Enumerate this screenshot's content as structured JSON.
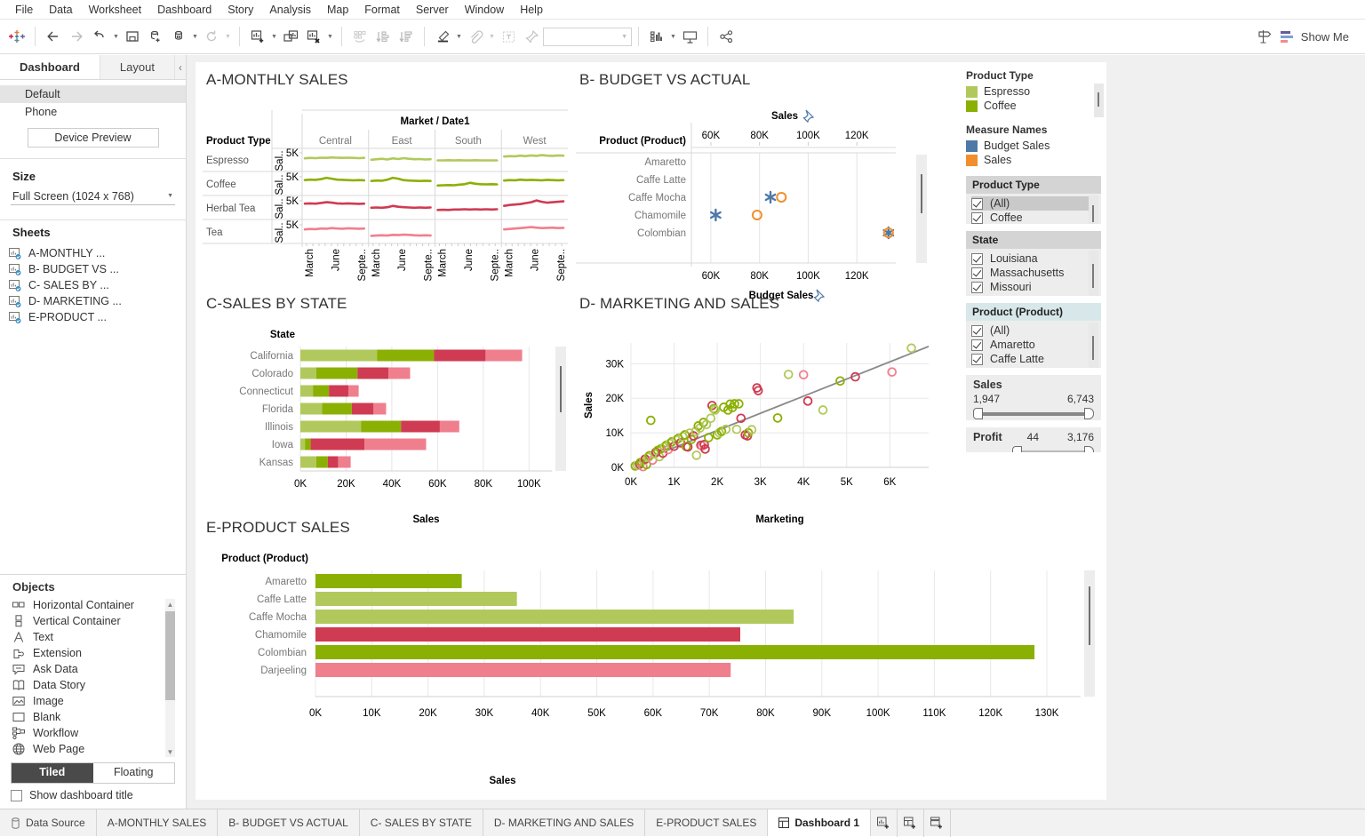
{
  "menubar": [
    "File",
    "Data",
    "Worksheet",
    "Dashboard",
    "Story",
    "Analysis",
    "Map",
    "Format",
    "Server",
    "Window",
    "Help"
  ],
  "toolbar": {
    "show_me_label": "Show Me",
    "combo_value": ""
  },
  "left_panel": {
    "tabs": [
      {
        "label": "Dashboard",
        "active": true
      },
      {
        "label": "Layout",
        "active": false
      }
    ],
    "collapse_icon": "chevron-left-icon",
    "devices": [
      "Default",
      "Phone"
    ],
    "device_preview_label": "Device Preview",
    "size": {
      "title": "Size",
      "value": "Full Screen (1024 x 768)"
    },
    "sheets": {
      "title": "Sheets",
      "items": [
        "A-MONTHLY ...",
        "B- BUDGET VS ...",
        "C- SALES BY ...",
        "D- MARKETING ...",
        "E-PRODUCT ..."
      ]
    },
    "objects": {
      "title": "Objects",
      "items": [
        {
          "label": "Horizontal Container",
          "icon": "horizontal-container-icon"
        },
        {
          "label": "Vertical Container",
          "icon": "vertical-container-icon"
        },
        {
          "label": "Text",
          "icon": "text-icon"
        },
        {
          "label": "Extension",
          "icon": "extension-icon"
        },
        {
          "label": "Ask Data",
          "icon": "ask-data-icon"
        },
        {
          "label": "Data Story",
          "icon": "data-story-icon"
        },
        {
          "label": "Image",
          "icon": "image-icon"
        },
        {
          "label": "Blank",
          "icon": "blank-icon"
        },
        {
          "label": "Workflow",
          "icon": "workflow-icon"
        },
        {
          "label": "Web Page",
          "icon": "web-page-icon"
        }
      ]
    },
    "tiled_label": "Tiled",
    "floating_label": "Floating",
    "show_title_label": "Show dashboard title"
  },
  "legends": {
    "product_type": {
      "title": "Product Type",
      "items": [
        {
          "label": "Espresso",
          "color": "#b1c95c"
        },
        {
          "label": "Coffee",
          "color": "#8bb004"
        }
      ]
    },
    "measure_names": {
      "title": "Measure Names",
      "items": [
        {
          "label": "Budget Sales",
          "color": "#4e79a7"
        },
        {
          "label": "Sales",
          "color": "#f28e2b"
        }
      ]
    }
  },
  "filters": [
    {
      "title": "Product Type",
      "items": [
        "(All)",
        "Coffee"
      ],
      "highlight_index": 0
    },
    {
      "title": "State",
      "items": [
        "Louisiana",
        "Massachusetts",
        "Missouri"
      ],
      "highlight_index": -1
    },
    {
      "title": "Product (Product)",
      "items": [
        "(All)",
        "Amaretto",
        "Caffe Latte"
      ],
      "highlight_index": -1
    }
  ],
  "range_filters": [
    {
      "title": "Sales",
      "min": "1,947",
      "max": "6,743"
    },
    {
      "title": "Profit",
      "min": "44",
      "max": "3,176"
    }
  ],
  "chart_data": [
    {
      "id": "a",
      "type": "line",
      "title": "A-MONTHLY SALES",
      "row_header": "Product Type",
      "column_header": "Market / Date1",
      "columns": [
        "Central",
        "East",
        "South",
        "West"
      ],
      "rows": [
        "Espresso",
        "Coffee",
        "Herbal Tea",
        "Tea"
      ],
      "row_axis_label": "Sal..",
      "ytick": "5K",
      "xticks": [
        "March",
        "June",
        "Septe.."
      ],
      "row_colors": [
        "#b1c95c",
        "#8bb004",
        "#cf3b52",
        "#f07f8e"
      ],
      "series": [
        {
          "row": "Espresso",
          "col": "Central",
          "values": [
            50,
            52,
            51,
            53,
            52,
            54,
            53,
            52,
            53,
            52,
            51,
            52
          ]
        },
        {
          "row": "Espresso",
          "col": "East",
          "values": [
            44,
            46,
            48,
            45,
            50,
            47,
            51,
            48,
            46,
            47,
            45,
            46
          ]
        },
        {
          "row": "Espresso",
          "col": "South",
          "values": [
            41,
            41,
            42,
            41,
            42,
            41,
            41,
            42,
            41,
            41,
            41,
            41
          ]
        },
        {
          "row": "Espresso",
          "col": "West",
          "values": [
            58,
            60,
            59,
            62,
            60,
            63,
            61,
            64,
            62,
            61,
            63,
            62
          ]
        },
        {
          "row": "Coffee",
          "col": "Central",
          "values": [
            60,
            62,
            61,
            64,
            70,
            66,
            62,
            61,
            60,
            59,
            60,
            59
          ]
        },
        {
          "row": "Coffee",
          "col": "East",
          "values": [
            56,
            58,
            57,
            62,
            70,
            66,
            60,
            58,
            57,
            56,
            57,
            56
          ]
        },
        {
          "row": "Coffee",
          "col": "South",
          "values": [
            36,
            37,
            38,
            37,
            40,
            42,
            48,
            44,
            42,
            41,
            42,
            41
          ]
        },
        {
          "row": "Coffee",
          "col": "West",
          "values": [
            58,
            60,
            59,
            62,
            60,
            61,
            60,
            59,
            61,
            60,
            59,
            60
          ]
        },
        {
          "row": "Herbal Tea",
          "col": "Central",
          "values": [
            62,
            63,
            62,
            65,
            68,
            66,
            63,
            62,
            63,
            62,
            61,
            62
          ]
        },
        {
          "row": "Herbal Tea",
          "col": "East",
          "values": [
            44,
            45,
            44,
            46,
            52,
            48,
            46,
            45,
            44,
            45,
            44,
            45
          ]
        },
        {
          "row": "Herbal Tea",
          "col": "South",
          "values": [
            34,
            35,
            34,
            36,
            36,
            37,
            36,
            37,
            36,
            37,
            36,
            37
          ]
        },
        {
          "row": "Herbal Tea",
          "col": "West",
          "values": [
            52,
            56,
            58,
            60,
            64,
            68,
            76,
            70,
            66,
            68,
            70,
            72
          ]
        },
        {
          "row": "Tea",
          "col": "Central",
          "values": [
            54,
            56,
            55,
            58,
            57,
            60,
            58,
            57,
            59,
            58,
            57,
            58
          ]
        },
        {
          "row": "Tea",
          "col": "East",
          "values": [
            26,
            27,
            28,
            27,
            30,
            29,
            31,
            30,
            28,
            27,
            28,
            27
          ]
        },
        {
          "row": "Tea",
          "col": "South",
          "values": []
        },
        {
          "row": "Tea",
          "col": "West",
          "values": [
            54,
            56,
            58,
            60,
            62,
            64,
            62,
            60,
            61,
            62,
            60,
            61
          ]
        }
      ]
    },
    {
      "id": "b",
      "type": "scatter",
      "title": "B- BUDGET VS ACTUAL",
      "row_header": "Product (Product)",
      "top_axis_label": "Sales",
      "bottom_axis_label": "Budget Sales",
      "top_ticks": [
        "60K",
        "80K",
        "100K",
        "120K"
      ],
      "bottom_ticks": [
        "60K",
        "80K",
        "100K",
        "120K"
      ],
      "rows": [
        "Amaretto",
        "Caffe Latte",
        "Caffe Mocha",
        "Chamomile",
        "Colombian"
      ],
      "points": [
        {
          "row": "Caffe Mocha",
          "budget": 84.5,
          "sales": 89.0
        },
        {
          "row": "Chamomile",
          "budget": 62.0,
          "sales": 79.0
        },
        {
          "row": "Colombian",
          "budget": 133.0,
          "sales": 133.0
        }
      ],
      "budget_color": "#4e79a7",
      "sales_color": "#f28e2b"
    },
    {
      "id": "c",
      "type": "bar",
      "title": "C-SALES BY STATE",
      "row_header": "State",
      "xlabel": "Sales",
      "xticks": [
        "0K",
        "20K",
        "40K",
        "60K",
        "80K",
        "100K"
      ],
      "xmax": 110,
      "categories": [
        "California",
        "Colorado",
        "Connecticut",
        "Florida",
        "Illinois",
        "Iowa",
        "Kansas"
      ],
      "segment_names": [
        "Espresso",
        "Coffee",
        "Herbal Tea",
        "Tea"
      ],
      "segment_colors": [
        "#b1c95c",
        "#8bb004",
        "#cf3b52",
        "#f07f8e"
      ],
      "values": [
        [
          33.5,
          25.0,
          22.5,
          16.0
        ],
        [
          7.0,
          18.0,
          13.5,
          9.5
        ],
        [
          5.5,
          7.0,
          8.5,
          4.5
        ],
        [
          9.5,
          13.0,
          9.5,
          5.5
        ],
        [
          26.5,
          17.5,
          17.0,
          8.5
        ],
        [
          2.0,
          2.5,
          23.5,
          27.0
        ],
        [
          7.0,
          5.0,
          4.5,
          5.5
        ]
      ]
    },
    {
      "id": "d",
      "type": "scatter",
      "title": "D- MARKETING AND SALES",
      "xlabel": "Marketing",
      "ylabel": "Sales",
      "xticks": [
        "0K",
        "1K",
        "2K",
        "3K",
        "4K",
        "5K",
        "6K"
      ],
      "yticks": [
        "0K",
        "10K",
        "20K",
        "30K"
      ],
      "xlim": [
        0,
        6.9
      ],
      "ylim": [
        0,
        36
      ],
      "trendline": {
        "x0": 0.05,
        "y0": 1.0,
        "x1": 6.9,
        "y1": 35.0
      },
      "point_colors": [
        "#8bb004",
        "#b1c95c",
        "#cf3b52",
        "#f07f8e"
      ],
      "points": [
        [
          0.1,
          0.4,
          0
        ],
        [
          0.15,
          0.6,
          1
        ],
        [
          0.2,
          0.9,
          2
        ],
        [
          0.22,
          1.4,
          0
        ],
        [
          0.28,
          0.2,
          3
        ],
        [
          0.3,
          1.9,
          1
        ],
        [
          0.33,
          2.4,
          2
        ],
        [
          0.36,
          0.8,
          0
        ],
        [
          0.4,
          2.9,
          1
        ],
        [
          0.43,
          3.4,
          0
        ],
        [
          0.46,
          13.6,
          0
        ],
        [
          0.5,
          2.1,
          3
        ],
        [
          0.55,
          3.9,
          1
        ],
        [
          0.58,
          4.4,
          2
        ],
        [
          0.62,
          4.9,
          0
        ],
        [
          0.66,
          3.1,
          1
        ],
        [
          0.7,
          5.4,
          0
        ],
        [
          0.74,
          4.1,
          2
        ],
        [
          0.78,
          5.9,
          1
        ],
        [
          0.82,
          6.4,
          0
        ],
        [
          0.86,
          5.1,
          3
        ],
        [
          0.9,
          6.9,
          1
        ],
        [
          0.95,
          7.4,
          0
        ],
        [
          1.0,
          6.1,
          2
        ],
        [
          1.05,
          7.9,
          1
        ],
        [
          1.1,
          8.4,
          0
        ],
        [
          1.15,
          7.1,
          2
        ],
        [
          1.2,
          8.9,
          1
        ],
        [
          1.25,
          9.4,
          0
        ],
        [
          1.28,
          6.0,
          0
        ],
        [
          1.32,
          5.9,
          2
        ],
        [
          1.36,
          9.9,
          1
        ],
        [
          1.4,
          8.1,
          0
        ],
        [
          1.45,
          9.1,
          2
        ],
        [
          1.5,
          10.4,
          1
        ],
        [
          1.52,
          3.5,
          1
        ],
        [
          1.56,
          12.0,
          0
        ],
        [
          1.6,
          11.4,
          1
        ],
        [
          1.62,
          6.4,
          2
        ],
        [
          1.65,
          6.2,
          3
        ],
        [
          1.68,
          13.0,
          0
        ],
        [
          1.7,
          6.6,
          2
        ],
        [
          1.72,
          5.3,
          2
        ],
        [
          1.75,
          12.4,
          1
        ],
        [
          1.8,
          8.6,
          0
        ],
        [
          1.85,
          14.2,
          1
        ],
        [
          1.88,
          17.9,
          2
        ],
        [
          1.92,
          17.0,
          0
        ],
        [
          1.95,
          16.6,
          1
        ],
        [
          2.0,
          9.4,
          0
        ],
        [
          2.05,
          10.0,
          1
        ],
        [
          2.1,
          10.4,
          0
        ],
        [
          2.15,
          17.4,
          0
        ],
        [
          2.2,
          11.0,
          1
        ],
        [
          2.25,
          16.6,
          0
        ],
        [
          2.3,
          18.3,
          0
        ],
        [
          2.35,
          17.3,
          0
        ],
        [
          2.4,
          18.4,
          0
        ],
        [
          2.45,
          11.0,
          1
        ],
        [
          2.5,
          18.4,
          0
        ],
        [
          2.55,
          14.2,
          2
        ],
        [
          2.65,
          9.4,
          2
        ],
        [
          2.7,
          9.1,
          2
        ],
        [
          2.72,
          10.0,
          0
        ],
        [
          2.8,
          10.9,
          1
        ],
        [
          2.92,
          23.0,
          2
        ],
        [
          2.95,
          22.2,
          2
        ],
        [
          3.4,
          14.3,
          0
        ],
        [
          3.65,
          26.9,
          1
        ],
        [
          4.0,
          26.8,
          3
        ],
        [
          4.1,
          19.2,
          2
        ],
        [
          4.45,
          16.6,
          1
        ],
        [
          4.85,
          25.0,
          0
        ],
        [
          5.2,
          26.2,
          2
        ],
        [
          6.05,
          27.6,
          3
        ],
        [
          6.5,
          34.5,
          1
        ]
      ]
    },
    {
      "id": "e",
      "type": "bar",
      "title": "E-PRODUCT SALES",
      "row_header": "Product (Product)",
      "xlabel": "Sales",
      "xticks": [
        "0K",
        "10K",
        "20K",
        "30K",
        "40K",
        "50K",
        "60K",
        "70K",
        "80K",
        "90K",
        "100K",
        "110K",
        "120K",
        "130K"
      ],
      "xmax": 136,
      "categories": [
        "Amaretto",
        "Caffe Latte",
        "Caffe Mocha",
        "Chamomile",
        "Colombian",
        "Darjeeling"
      ],
      "values": [
        26.0,
        35.8,
        85.0,
        75.5,
        127.8,
        73.8
      ],
      "colors": [
        "#8bb004",
        "#b1c95c",
        "#b1c95c",
        "#cf3b52",
        "#8bb004",
        "#f07f8e"
      ]
    }
  ],
  "statusbar": {
    "data_source_label": "Data Source",
    "tabs": [
      {
        "label": "A-MONTHLY SALES",
        "active": false
      },
      {
        "label": "B- BUDGET VS ACTUAL",
        "active": false
      },
      {
        "label": "C- SALES BY STATE",
        "active": false
      },
      {
        "label": "D- MARKETING AND SALES",
        "active": false
      },
      {
        "label": "E-PRODUCT SALES",
        "active": false
      },
      {
        "label": "Dashboard 1",
        "active": true
      }
    ],
    "add_icons": [
      "new-worksheet-icon",
      "new-dashboard-icon",
      "new-story-icon"
    ]
  }
}
